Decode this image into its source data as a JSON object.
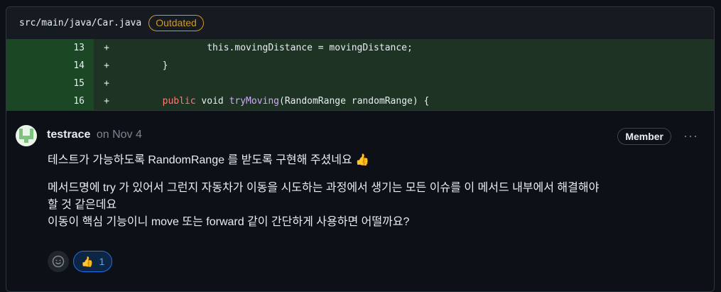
{
  "file": {
    "path": "src/main/java/Car.java",
    "badge": "Outdated"
  },
  "diff_lines": [
    {
      "num": "13",
      "marker": "+",
      "code": "this.movingDistance = movingDistance;"
    },
    {
      "num": "14",
      "marker": "+",
      "code": "}"
    },
    {
      "num": "15",
      "marker": "+",
      "code": ""
    },
    {
      "num": "16",
      "marker": "+",
      "code_kw1": "public",
      "code_kw2": "void",
      "code_fn": "tryMoving",
      "code_rest": "(RandomRange randomRange) {"
    }
  ],
  "comment": {
    "author": "testrace",
    "date": "on Nov 4",
    "role_badge": "Member",
    "more_label": "···",
    "paragraph1": "테스트가 가능하도록 RandomRange 를 받도록 구현해 주셨네요 👍",
    "paragraph2_line1": "메서드명에 try 가 있어서 그런지 자동차가 이동을 시도하는 과정에서 생기는 모든 이슈를 이 메서드 내부에서 해결해야",
    "paragraph2_line2": "할 것 같은데요",
    "paragraph2_line3": "이동이 핵심 기능이니 move 또는 forward 같이 간단하게 사용하면 어떨까요?"
  },
  "reactions": {
    "thumbs_up_count": "1"
  },
  "colors": {
    "badge_outdated": "#d29922",
    "diff_add_bg": "#1f3324",
    "reaction_border": "#1f6feb"
  }
}
